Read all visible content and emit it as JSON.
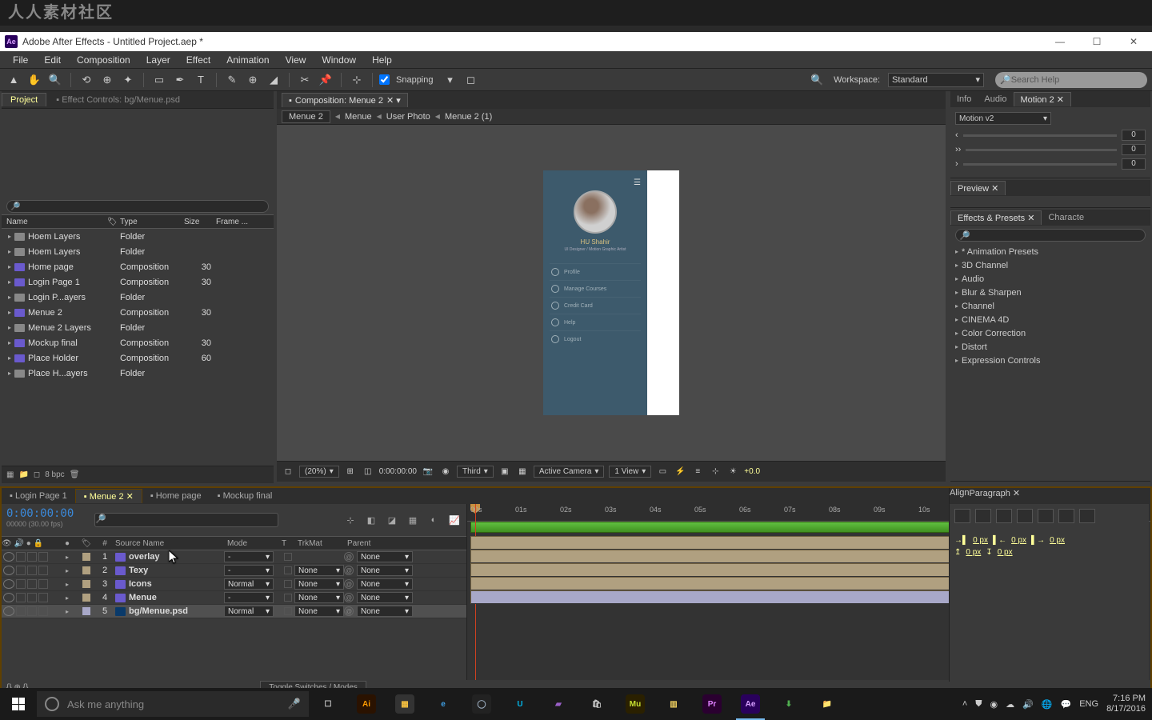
{
  "watermark": "人人素材社区",
  "titlebar": {
    "app": "Adobe After Effects - Untitled Project.aep *"
  },
  "menu": [
    "File",
    "Edit",
    "Composition",
    "Layer",
    "Effect",
    "Animation",
    "View",
    "Window",
    "Help"
  ],
  "toolbar": {
    "snapping": "Snapping",
    "workspace_label": "Workspace:",
    "workspace": "Standard",
    "search_placeholder": "Search Help"
  },
  "project": {
    "tab": "Project",
    "tab2": "Effect Controls: bg/Menue.psd",
    "headers": {
      "name": "Name",
      "type": "Type",
      "size": "Size",
      "frame": "Frame ..."
    },
    "items": [
      {
        "name": "Hoem Layers",
        "type": "Folder",
        "frame": "",
        "folder": true
      },
      {
        "name": "Hoem Layers",
        "type": "Folder",
        "frame": "",
        "folder": true
      },
      {
        "name": "Home page",
        "type": "Composition",
        "frame": "30",
        "folder": false
      },
      {
        "name": "Login Page 1",
        "type": "Composition",
        "frame": "30",
        "folder": false
      },
      {
        "name": "Login P...ayers",
        "type": "Folder",
        "frame": "",
        "folder": true
      },
      {
        "name": "Menue 2",
        "type": "Composition",
        "frame": "30",
        "folder": false
      },
      {
        "name": "Menue 2 Layers",
        "type": "Folder",
        "frame": "",
        "folder": true
      },
      {
        "name": "Mockup final",
        "type": "Composition",
        "frame": "30",
        "folder": false
      },
      {
        "name": "Place Holder",
        "type": "Composition",
        "frame": "60",
        "folder": false
      },
      {
        "name": "Place H...ayers",
        "type": "Folder",
        "frame": "",
        "folder": true
      }
    ],
    "bpc": "8 bpc"
  },
  "comp": {
    "tab": "Composition: Menue 2",
    "breadcrumb": [
      "Menue 2",
      "Menue",
      "User Photo",
      "Menue 2 (1)"
    ],
    "mock": {
      "user": "HU Shahir",
      "role": "UI Designer / Motion Graphic Artist",
      "items": [
        "Profile",
        "Manage Courses",
        "Credit Card",
        "Help",
        "Logout"
      ]
    },
    "footer": {
      "zoom": "(20%)",
      "time": "0:00:00:00",
      "res": "Third",
      "camera": "Active Camera",
      "view": "1 View",
      "exp": "+0.0"
    }
  },
  "motion": {
    "tab1": "Info",
    "tab2": "Audio",
    "tab3": "Motion 2",
    "preset": "Motion v2",
    "vals": [
      "0",
      "0",
      "0"
    ]
  },
  "preview": {
    "tab": "Preview"
  },
  "effects": {
    "tab": "Effects & Presets",
    "tab2": "Characte",
    "items": [
      "* Animation Presets",
      "3D Channel",
      "Audio",
      "Blur & Sharpen",
      "Channel",
      "CINEMA 4D",
      "Color Correction",
      "Distort",
      "Expression Controls"
    ]
  },
  "timeline": {
    "tabs": [
      "Login Page 1",
      "Menue 2",
      "Home page",
      "Mockup final"
    ],
    "active_tab": 1,
    "timecode": "0:00:00:00",
    "fps": "00000 (30.00 fps)",
    "cols": {
      "num": "#",
      "src": "Source Name",
      "mode": "Mode",
      "t": "T",
      "trk": "TrkMat",
      "parent": "Parent"
    },
    "layers": [
      {
        "n": "1",
        "name": "overlay",
        "mode": "-",
        "trk": "",
        "parent": "None",
        "sw": "#b0a080"
      },
      {
        "n": "2",
        "name": "Texy",
        "mode": "-",
        "trk": "None",
        "parent": "None",
        "sw": "#b0a080"
      },
      {
        "n": "3",
        "name": "Icons",
        "mode": "Normal",
        "trk": "None",
        "parent": "None",
        "sw": "#b0a080"
      },
      {
        "n": "4",
        "name": "Menue",
        "mode": "-",
        "trk": "None",
        "parent": "None",
        "sw": "#b0a080"
      },
      {
        "n": "5",
        "name": "bg/Menue.psd",
        "mode": "Normal",
        "trk": "None",
        "parent": "None",
        "sw": "#a8a8c8",
        "sel": true,
        "psd": true
      }
    ],
    "ticks": [
      "00s",
      "01s",
      "02s",
      "03s",
      "04s",
      "05s",
      "06s",
      "07s",
      "08s",
      "09s",
      "10s"
    ],
    "toggle": "Toggle Switches / Modes"
  },
  "bottom_right": {
    "align": "Align",
    "para": "Paragraph",
    "px": "0 px"
  },
  "taskbar": {
    "cortana": "Ask me anything",
    "apps": [
      {
        "name": "task-view",
        "bg": "transparent",
        "txt": "☐",
        "c": "#ccc"
      },
      {
        "name": "illustrator",
        "bg": "#2a1200",
        "txt": "Ai",
        "c": "#ff9a00"
      },
      {
        "name": "media",
        "bg": "#333",
        "txt": "▦",
        "c": "#f5c040"
      },
      {
        "name": "edge",
        "bg": "transparent",
        "txt": "e",
        "c": "#3fa0e5"
      },
      {
        "name": "cinema4d",
        "bg": "#222",
        "txt": "◯",
        "c": "#9ab"
      },
      {
        "name": "udacity",
        "bg": "transparent",
        "txt": "U",
        "c": "#02b3e4"
      },
      {
        "name": "visualstudio",
        "bg": "transparent",
        "txt": "▰",
        "c": "#9a60c8"
      },
      {
        "name": "store",
        "bg": "transparent",
        "txt": "🛍",
        "c": "#ccc"
      },
      {
        "name": "muse",
        "bg": "#2a2000",
        "txt": "Mu",
        "c": "#c8e030"
      },
      {
        "name": "notes",
        "bg": "transparent",
        "txt": "▥",
        "c": "#f0d060"
      },
      {
        "name": "premiere",
        "bg": "#2a0030",
        "txt": "Pr",
        "c": "#e080ff"
      },
      {
        "name": "aftereffects",
        "bg": "#29005c",
        "txt": "Ae",
        "c": "#d8a0ff",
        "active": true
      },
      {
        "name": "idm",
        "bg": "transparent",
        "txt": "⬇",
        "c": "#50b050"
      },
      {
        "name": "explorer",
        "bg": "transparent",
        "txt": "📁",
        "c": "#f0c050"
      }
    ],
    "lang": "ENG",
    "time": "7:16 PM",
    "date": "8/17/2016"
  }
}
